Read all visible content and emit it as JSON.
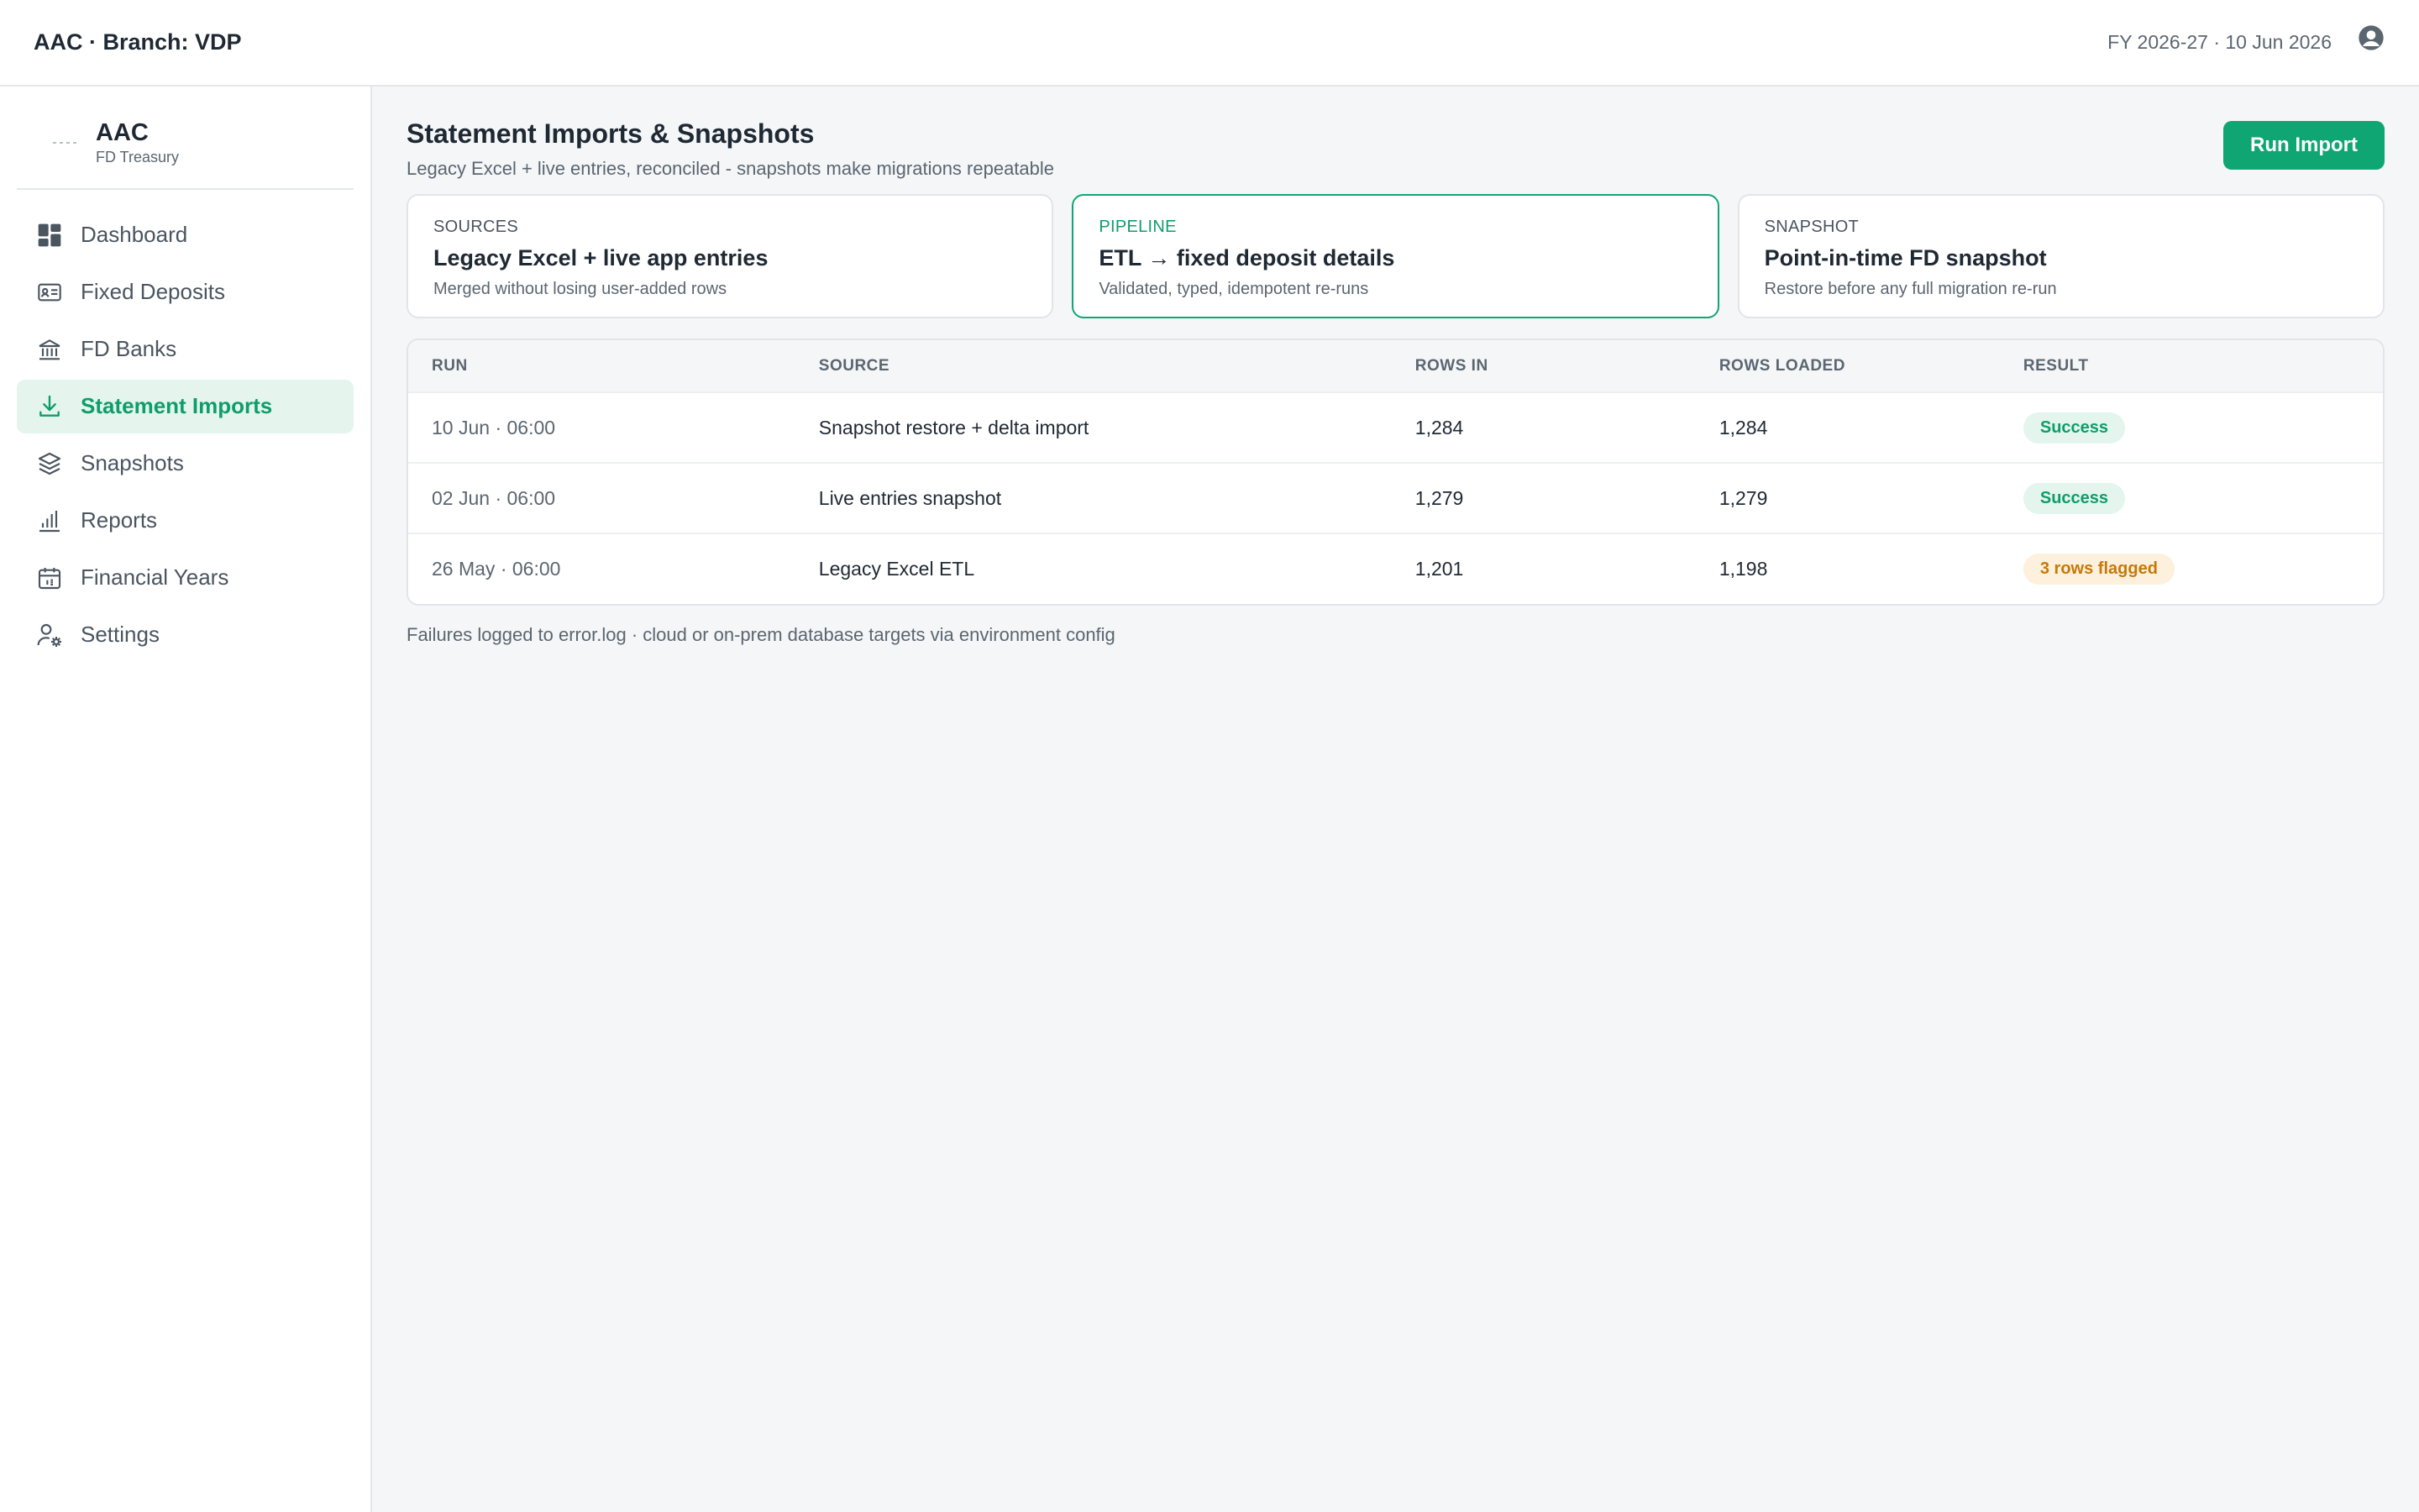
{
  "topbar": {
    "title": "AAC · Branch: VDP",
    "date": "FY 2026-27 · 10 Jun 2026",
    "user_icon": "user-circle-icon"
  },
  "brand": {
    "name": "AAC",
    "subtitle": "FD Treasury"
  },
  "sidebar": {
    "items": [
      {
        "label": "Dashboard",
        "icon": "dashboard-icon",
        "active": false
      },
      {
        "label": "Fixed Deposits",
        "icon": "id-card-icon",
        "active": false
      },
      {
        "label": "FD Banks",
        "icon": "bank-icon",
        "active": false
      },
      {
        "label": "Statement Imports",
        "icon": "download-icon",
        "active": true
      },
      {
        "label": "Snapshots",
        "icon": "layers-icon",
        "active": false
      },
      {
        "label": "Reports",
        "icon": "bar-chart-icon",
        "active": false
      },
      {
        "label": "Financial Years",
        "icon": "calendar-icon",
        "active": false
      },
      {
        "label": "Settings",
        "icon": "user-gear-icon",
        "active": false
      }
    ]
  },
  "page": {
    "title": "Statement Imports & Snapshots",
    "subtitle": "Legacy Excel + live entries, reconciled - snapshots make migrations repeatable",
    "run_button": "Run Import"
  },
  "cards": [
    {
      "label": "SOURCES",
      "title": "Legacy Excel + live app entries",
      "subtitle": "Merged without losing user-added rows",
      "highlight": false
    },
    {
      "label": "PIPELINE",
      "title": "ETL → fixed deposit details",
      "subtitle": "Validated, typed, idempotent re-runs",
      "highlight": true
    },
    {
      "label": "SNAPSHOT",
      "title": "Point-in-time FD snapshot",
      "subtitle": "Restore before any full migration re-run",
      "highlight": false
    }
  ],
  "table": {
    "headers": [
      "RUN",
      "SOURCE",
      "ROWS IN",
      "ROWS LOADED",
      "RESULT"
    ],
    "rows": [
      {
        "run": "10 Jun · 06:00",
        "source": "Snapshot restore + delta import",
        "rows_in": "1,284",
        "rows_loaded": "1,284",
        "result": "Success",
        "status": "ok"
      },
      {
        "run": "02 Jun · 06:00",
        "source": "Live entries snapshot",
        "rows_in": "1,279",
        "rows_loaded": "1,279",
        "result": "Success",
        "status": "ok"
      },
      {
        "run": "26 May · 06:00",
        "source": "Legacy Excel ETL",
        "rows_in": "1,201",
        "rows_loaded": "1,198",
        "result": "3 rows flagged",
        "status": "warn"
      }
    ]
  },
  "footnote": "Failures logged to error.log · cloud or on-prem database targets via environment config",
  "colors": {
    "accent": "#10a673",
    "accent_bg": "#e5f5ee",
    "warning": "#c4790a",
    "warning_bg": "#fdf0dc"
  }
}
